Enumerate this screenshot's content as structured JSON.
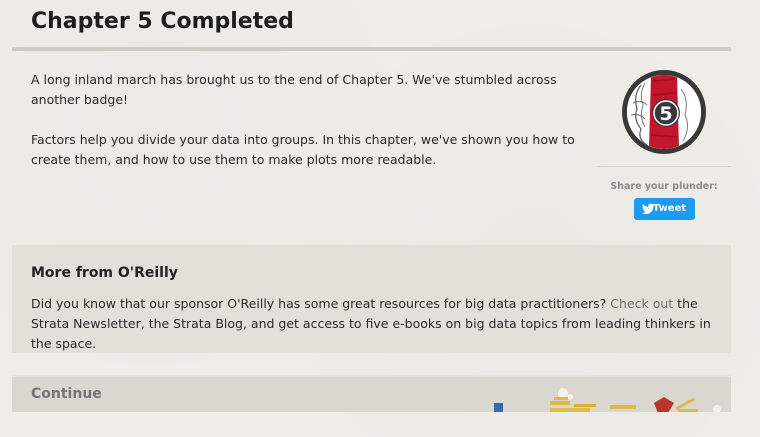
{
  "header": {
    "title": "Chapter 5 Completed"
  },
  "main": {
    "paragraph_1": "A long inland march has brought us to the end of Chapter 5. We've stumbled across another badge!",
    "paragraph_2": "Factors help you divide your data into groups. In this chapter, we've shown you how to create them, and how to use them to make plots more readable."
  },
  "badge": {
    "number": "5"
  },
  "share": {
    "label": "Share your plunder:",
    "tweet_label": "Tweet"
  },
  "oreilly": {
    "title": "More from O'Reilly",
    "text_before_link": "Did you know that our sponsor O'Reilly has some great resources for big data practitioners? ",
    "link_label": "Check out",
    "text_after_link": " the Strata Newsletter, the Strata Blog, and get access to five e-books on big data topics from leading thinkers in the space."
  },
  "continue": {
    "label": "Continue"
  },
  "colors": {
    "tweet_blue": "#1d9bf0",
    "badge_red": "#c3152b",
    "badge_ring": "#3a3838",
    "gold": "#e0b94a"
  }
}
